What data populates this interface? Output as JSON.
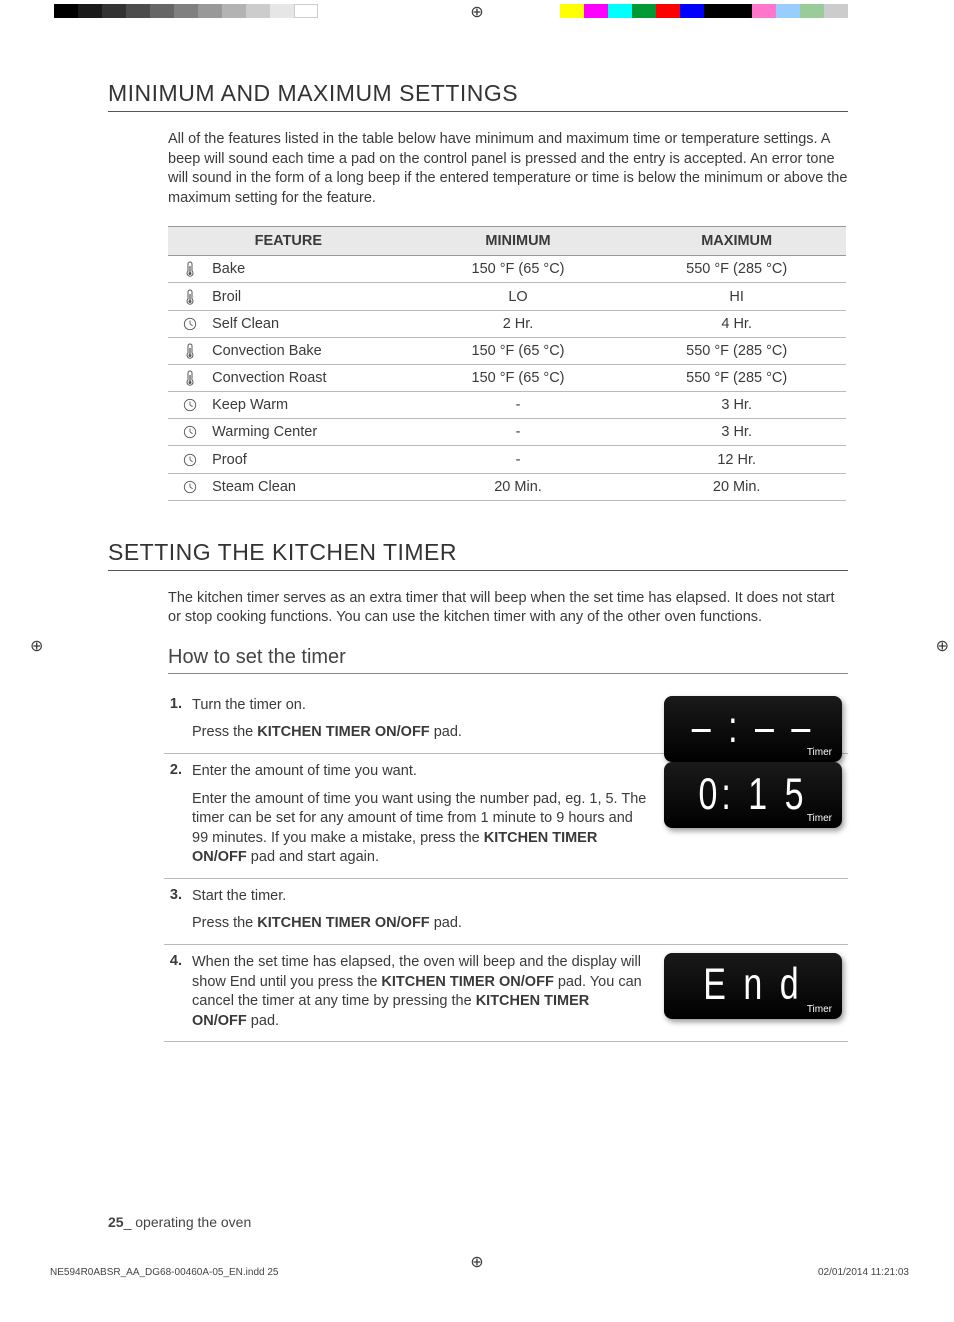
{
  "section1": {
    "title": "MINIMUM AND MAXIMUM SETTINGS",
    "intro": "All of the features listed in the table below have minimum and maximum time or temperature settings. A beep will sound each time a pad on the control panel is pressed and the entry is accepted. An error tone will sound in the form of a long beep if the entered temperature or time is below the minimum or above the maximum setting for the feature.",
    "table": {
      "headers": [
        "FEATURE",
        "MINIMUM",
        "MAXIMUM"
      ],
      "rows": [
        {
          "icon": "therm",
          "feature": "Bake",
          "min": "150 °F (65 °C)",
          "max": "550 °F (285 °C)"
        },
        {
          "icon": "therm",
          "feature": "Broil",
          "min": "LO",
          "max": "HI"
        },
        {
          "icon": "clock",
          "feature": "Self Clean",
          "min": "2 Hr.",
          "max": "4 Hr."
        },
        {
          "icon": "therm",
          "feature": "Convection Bake",
          "min": "150 °F (65 °C)",
          "max": "550 °F (285 °C)"
        },
        {
          "icon": "therm",
          "feature": "Convection Roast",
          "min": "150 °F (65 °C)",
          "max": "550 °F (285 °C)"
        },
        {
          "icon": "clock",
          "feature": "Keep Warm",
          "min": "-",
          "max": "3 Hr."
        },
        {
          "icon": "clock",
          "feature": "Warming Center",
          "min": "-",
          "max": "3 Hr."
        },
        {
          "icon": "clock",
          "feature": "Proof",
          "min": "-",
          "max": "12 Hr."
        },
        {
          "icon": "clock",
          "feature": "Steam Clean",
          "min": "20 Min.",
          "max": "20 Min."
        }
      ]
    }
  },
  "section2": {
    "title": "SETTING THE KITCHEN TIMER",
    "intro": "The kitchen timer serves as an extra timer that will beep when the set time has elapsed. It does not start or stop cooking functions. You can use the kitchen timer with any of the other oven functions.",
    "subsec": "How to set the timer",
    "steps": [
      {
        "num": "1.",
        "title": "Turn the timer on.",
        "detail_pre": "Press the ",
        "detail_bold": "KITCHEN TIMER ON/OFF",
        "detail_post": " pad.",
        "display": "‒ : ‒ ‒",
        "display_label": "Timer"
      },
      {
        "num": "2.",
        "title": "Enter the amount of time you want.",
        "detail_pre": "Enter the amount of time you want using the number pad, eg. 1, 5. The timer can be set for any amount of time from 1 minute to 9 hours and 99 minutes. If you make a mistake, press the ",
        "detail_bold": "KITCHEN TIMER ON/OFF",
        "detail_post": " pad and start again.",
        "display": "0: 1 5",
        "display_label": "Timer"
      },
      {
        "num": "3.",
        "title": "Start the timer.",
        "detail_pre": "Press the ",
        "detail_bold": "KITCHEN TIMER ON/OFF",
        "detail_post": " pad.",
        "display": "",
        "display_label": ""
      },
      {
        "num": "4.",
        "title": "",
        "detail_full_pre": "When the set time has elapsed, the oven will beep and the display will show End until you press the ",
        "detail_bold1": "KITCHEN TIMER ON/OFF",
        "detail_mid": " pad. You can cancel the timer at any time by pressing the ",
        "detail_bold2": "KITCHEN TIMER ON/OFF",
        "detail_end": " pad.",
        "display": "E n d",
        "display_label": "Timer"
      }
    ]
  },
  "footer": {
    "page_num": "25",
    "page_suffix": "_ operating the oven",
    "indd": "NE594R0ABSR_AA_DG68-00460A-05_EN.indd   25",
    "timestamp": "02/01/2014   11:21:03"
  }
}
